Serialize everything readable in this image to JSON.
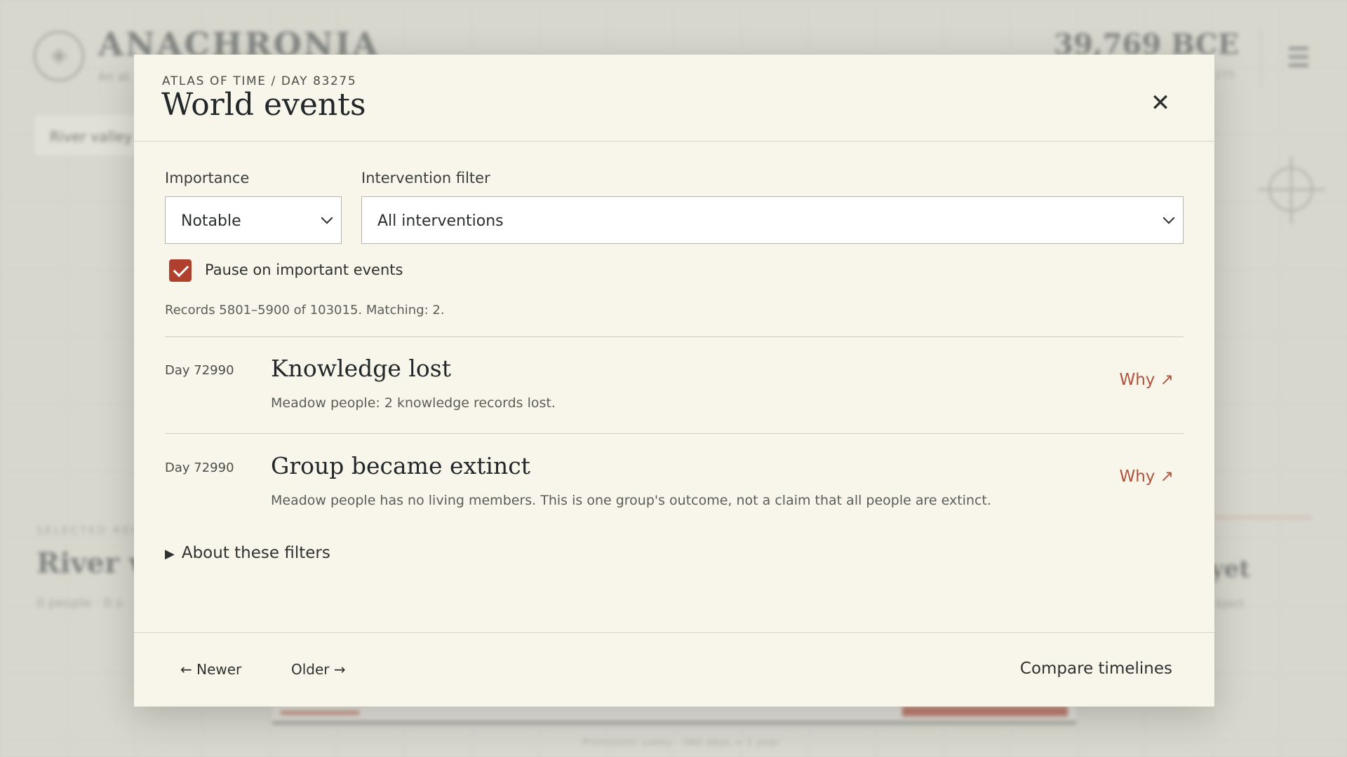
{
  "background": {
    "brand": "ANACHRONIA",
    "tagline": "An at",
    "date": "39,769 BCE",
    "subdate": "275",
    "region_button": "River valley",
    "selected_label": "SELECTED REG",
    "region_name": "River v",
    "region_stats": "0 people · 0 o",
    "right_heading": "yet",
    "right_sub": "bject",
    "footer_text": "Prehistoric valley · 360 days = 1 year"
  },
  "modal": {
    "breadcrumb": "ATLAS OF TIME / DAY 83275",
    "title": "World events",
    "close_symbol": "✕"
  },
  "filters": {
    "importance_label": "Importance",
    "importance_value": "Notable",
    "intervention_label": "Intervention filter",
    "intervention_value": "All interventions",
    "pause_label": "Pause on important events",
    "pause_checked": true
  },
  "records_text": "Records 5801–5900 of 103015. Matching: 2.",
  "events": [
    {
      "day": "Day 72990",
      "title": "Knowledge lost",
      "description": "Meadow people: 2 knowledge records lost.",
      "why_label": "Why ↗"
    },
    {
      "day": "Day 72990",
      "title": "Group became extinct",
      "description": "Meadow people has no living members. This is one group's outcome, not a claim that all people are extinct.",
      "why_label": "Why ↗"
    }
  ],
  "about_label": "About these filters",
  "footer": {
    "newer_label": "← Newer",
    "older_label": "Older →",
    "compare_label": "Compare timelines"
  },
  "colors": {
    "accent": "#b0402e",
    "link": "#b0543f",
    "modal_bg": "#f8f6ea"
  }
}
